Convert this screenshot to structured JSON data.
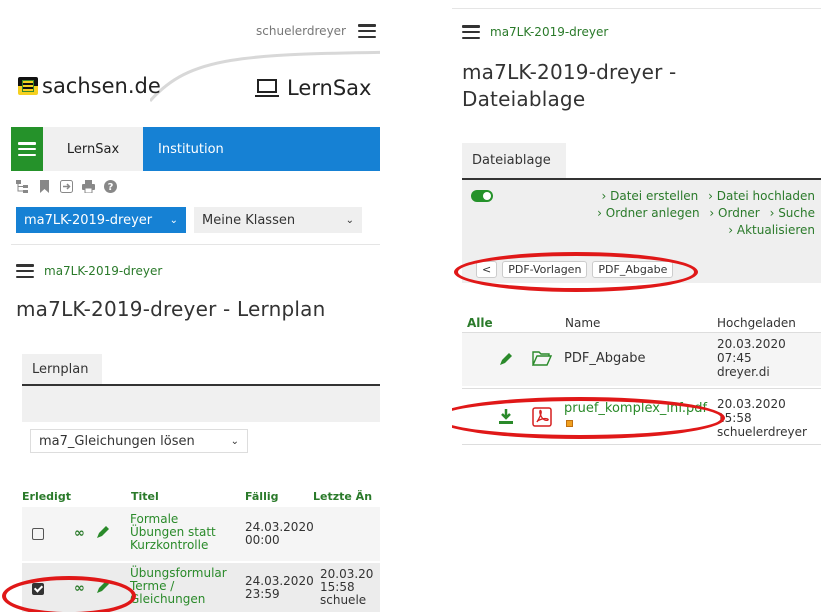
{
  "left": {
    "username": "schuelerdreyer",
    "sachsen_logo": "sachsen.de",
    "lernsax_logo": "LernSax",
    "nav": {
      "tab_lernsax": "LernSax",
      "tab_institution": "Institution"
    },
    "class_select": "ma7LK-2019-dreyer",
    "my_classes_select": "Meine Klassen",
    "breadcrumb": "ma7LK-2019-dreyer",
    "page_title": "ma7LK-2019-dreyer - Lernplan",
    "subtab": "Lernplan",
    "plan_select": "ma7_Gleichungen lösen",
    "table": {
      "headers": [
        "Erledigt",
        "Titel",
        "Fällig",
        "Letzte Än"
      ],
      "rows": [
        {
          "checked": false,
          "title": [
            "Formale",
            "Übungen statt",
            "Kurzkontrolle"
          ],
          "due": [
            "24.03.2020",
            "00:00"
          ],
          "last": [
            "",
            "",
            ""
          ]
        },
        {
          "checked": true,
          "title": [
            "Übungsformular",
            "Terme /",
            "Gleichungen"
          ],
          "due": [
            "24.03.2020",
            "23:59"
          ],
          "last": [
            "20.03.20",
            "15:58",
            "schuele"
          ]
        }
      ]
    }
  },
  "right": {
    "breadcrumb": "ma7LK-2019-dreyer",
    "page_title_line1": "ma7LK-2019-dreyer -",
    "page_title_line2": "Dateiablage",
    "subtab": "Dateiablage",
    "actions": {
      "create_file": "› Datei erstellen",
      "upload_file": "› Datei hochladen",
      "create_folder": "› Ordner anlegen",
      "folder": "› Ordner",
      "search": "› Suche",
      "refresh": "› Aktualisieren"
    },
    "path": {
      "back": "<",
      "p1": "PDF-Vorlagen",
      "p2": "PDF_Abgabe"
    },
    "headers": {
      "all": "Alle",
      "name": "Name",
      "uploaded": "Hochgeladen"
    },
    "files": [
      {
        "name": "PDF_Abgabe",
        "date": [
          "20.03.2020",
          "07:45",
          "dreyer.di"
        ]
      },
      {
        "name": "pruef_komplex_inf.pdf",
        "date": [
          "20.03.2020",
          "15:58",
          "schuelerdreyer"
        ]
      }
    ]
  },
  "colors": {
    "accent_blue": "#1681d4",
    "accent_green": "#25922a",
    "link_green": "#2a7a2a",
    "highlight_red": "#e01818"
  }
}
